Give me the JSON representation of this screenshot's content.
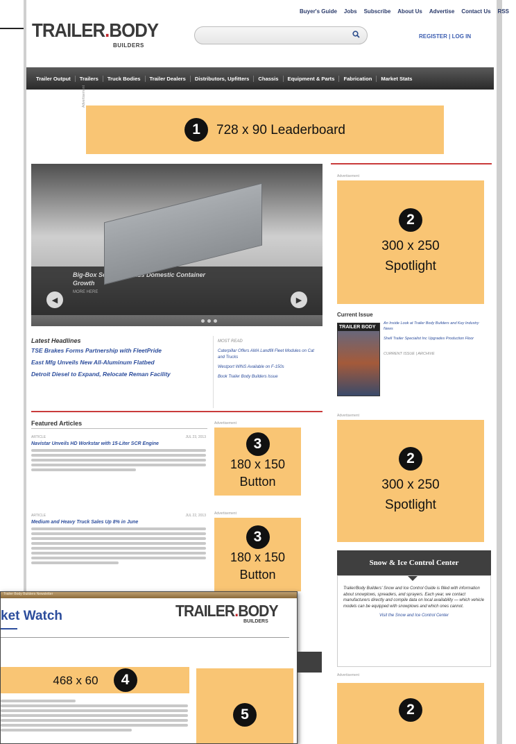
{
  "topbar": [
    "Buyer's Guide",
    "Jobs",
    "Subscribe",
    "About Us",
    "Advertise",
    "Contact Us",
    "RSS"
  ],
  "logo": {
    "main_left": "TRAILER",
    "dot": ".",
    "main_right": "BODY",
    "sub": "BUILDERS"
  },
  "header": {
    "search_placeholder": "",
    "search_icon": "search-icon",
    "register_login": "REGISTER  |  LOG IN"
  },
  "nav": [
    "Trailer Output",
    "Trailers",
    "Truck Bodies",
    "Trailer Dealers",
    "Distributors, Upfitters",
    "Chassis",
    "Equipment & Parts",
    "Fabrication",
    "Market Stats"
  ],
  "ads": {
    "leaderboard": {
      "num": "1",
      "text": "728 x 90 Leaderboard"
    },
    "spotlight1": {
      "num": "2",
      "line1": "300 x 250",
      "line2": "Spotlight"
    },
    "spotlight2": {
      "num": "2",
      "line1": "300 x 250",
      "line2": "Spotlight"
    },
    "spotlight3": {
      "num": "2"
    },
    "button1": {
      "num": "3",
      "line1": "180 x 150",
      "line2": "Button"
    },
    "button2": {
      "num": "3",
      "line1": "180 x 150",
      "line2": "Button"
    },
    "banner": {
      "num": "4",
      "text": "468 x 60"
    },
    "box5": {
      "num": "5"
    },
    "label": "Advertisement"
  },
  "hero": {
    "caption": "Big-Box Segment Leads Domestic Container Growth",
    "date": "MORE HERE"
  },
  "headlines": {
    "title": "Latest Headlines",
    "items": [
      "TSE Brakes Forms Partnership with FleetPride",
      "East Mfg Unveils New All-Aluminum Flatbed",
      "Detroit Diesel to Expand, Relocate Reman Facility"
    ]
  },
  "mini_links": [
    "MOST READ",
    "Caterpillar Offers AMA Landfill Fleet Modules on Cat and Trucks",
    "Westport WINS Available on F-150s",
    "Book Trailer Body Builders Issue"
  ],
  "featured": {
    "title": "Featured Articles",
    "articles": [
      {
        "meta": "ARTICLE",
        "date": "JUL 23, 2013",
        "title": "Navistar Unveils HD Workstar with 15-Liter SCR Engine"
      },
      {
        "meta": "ARTICLE",
        "date": "JUL 22, 2013",
        "title": "Medium and Heavy Truck Sales Up 8% in June"
      }
    ]
  },
  "current_issue": {
    "title": "Current Issue",
    "cover_title": "TRAILER BODY",
    "links": [
      "An Inside Look at Trailer Body Builders and Key Industry News",
      "Shell Trailer Specialist Inc Upgrades Production Floor",
      "CURRENT ISSUE  |  ARCHIVE"
    ]
  },
  "snow": {
    "title": "Snow & Ice Control Center",
    "body": "Trailer/Body Builders' Snow and Ice Control Guide is filled with information about snowplows, spreaders, and sprayers. Each year, we contact manufacturers directly and compile data on local availability — which vehicle models can be equipped with snowplows and which ones cannot.",
    "link": "Visit the Snow and Ice Control Center"
  },
  "inset": {
    "titlebar": "Trailer Body Builders Newsletter",
    "heading": "ket Watch",
    "logo_left": "TRAILER",
    "logo_dot": ".",
    "logo_right": "BODY",
    "logo_sub": "BUILDERS"
  },
  "colors": {
    "ad": "#f9c574",
    "nav": "#3a3a3a",
    "accent_red": "#c93a3a",
    "link": "#2c4d9c"
  }
}
